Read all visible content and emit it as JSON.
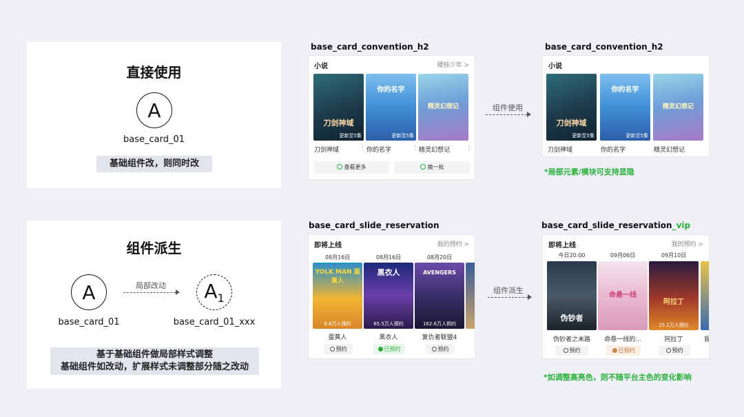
{
  "direct": {
    "title": "直接使用",
    "circle": "A",
    "label": "base_card_01",
    "tag": "基础组件改，则同时改"
  },
  "derive": {
    "title": "组件派生",
    "circle_a": "A",
    "circle_a1": "A",
    "circle_a1_sub": "1",
    "arrow_text": "局部改动",
    "label_a": "base_card_01",
    "label_a1": "base_card_01_xxx",
    "tag_line1": "基于基础组件做局部样式调整",
    "tag_line2": "基础组件如改动，扩展样式未调整部分随之改动"
  },
  "top_left": {
    "name": "base_card_convention_h2",
    "head": "小说",
    "more": "硬核少年 >",
    "posters": [
      {
        "title": "刀剑神域",
        "art": "刀剑神域",
        "cap": "更新至5集"
      },
      {
        "title": "你的名字",
        "art": "你的名字",
        "cap": "更新至5集"
      },
      {
        "title": "精灵幻想记",
        "art": "精灵幻想记",
        "cap": ""
      }
    ],
    "btn_more": "查看更多",
    "btn_change": "换一批"
  },
  "top_arrow": "组件使用",
  "top_right": {
    "name": "base_card_convention_h2",
    "head": "小说",
    "posters": [
      {
        "title": "刀剑神域",
        "art": "刀剑神域",
        "cap": "更新至5集"
      },
      {
        "title": "你的名字",
        "art": "你的名字",
        "cap": "更新至5集"
      },
      {
        "title": "精灵幻想记",
        "art": "精灵幻想记",
        "cap": ""
      }
    ],
    "note": "*局部元素/模块可支持显隐"
  },
  "bottom_left": {
    "name": "base_card_slide_reservation",
    "head": "即将上线",
    "more": "我的预约 >",
    "items": [
      {
        "date": "08月16日",
        "title": "蛋黄人",
        "art": "YOLK MAN 蛋黄人",
        "cap": "8.8万人预约",
        "btn": "预约",
        "state": "normal"
      },
      {
        "date": "08月16日",
        "title": "黑衣人",
        "art": "黑衣人",
        "cap": "65.5万人预约",
        "btn": "已预约",
        "state": "done"
      },
      {
        "date": "08月20日",
        "title": "复仇者联盟4",
        "art": "AVENGERS",
        "cap": "162.6万人预约",
        "btn": "预约",
        "state": "normal"
      }
    ]
  },
  "bottom_arrow": "组件派生",
  "bottom_right": {
    "name_prefix": "base_card_slide_reservation",
    "name_suffix": "_vip",
    "head": "即将上线",
    "more": "我的预约 >",
    "items": [
      {
        "date": "今日20:00",
        "title": "伪钞者之末路",
        "art": "伪钞者",
        "cap": "",
        "btn": "预约",
        "state": "normal"
      },
      {
        "date": "09月06日",
        "title": "命悬一线的...",
        "art": "命悬一线",
        "cap": "",
        "btn": "已预约",
        "state": "vipdone"
      },
      {
        "date": "09月10日",
        "title": "阿拉丁",
        "art": "阿拉丁",
        "cap": "25.1万人预约",
        "btn": "预约",
        "state": "normal"
      }
    ],
    "partial_title": "我",
    "note": "*如调整高亮色，则不随平台主色的变化影响"
  },
  "colors": {
    "accent_green": "#2ab03a",
    "vip_gold": "#b8753d",
    "background": "#eef0f5"
  }
}
